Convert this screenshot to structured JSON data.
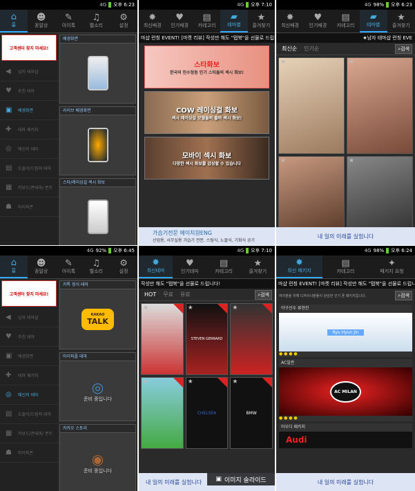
{
  "panels": {
    "p1": {
      "status": {
        "network": "4G",
        "time": "오후 6:23"
      },
      "nav": [
        {
          "label": "홈",
          "icon": "home-icon",
          "glyph": "⌂"
        },
        {
          "label": "꽁알상",
          "icon": "mascot-icon",
          "glyph": "☻"
        },
        {
          "label": "아이톡",
          "icon": "chat-icon",
          "glyph": "✎"
        },
        {
          "label": "벨소리",
          "icon": "music-note-icon",
          "glyph": "♫"
        },
        {
          "label": "설정",
          "icon": "gear-icon",
          "glyph": "⚙"
        }
      ],
      "logo": "고객센터 찾지 마세요!",
      "sidebar": [
        {
          "label": "남자 테마샵",
          "icon": "megaphone-icon",
          "glyph": "◀"
        },
        {
          "label": "추천 테마",
          "icon": "thumb-up-icon",
          "glyph": "♥"
        },
        {
          "label": "배경화면",
          "icon": "image-icon",
          "glyph": "▣"
        },
        {
          "label": "테마 패키지",
          "icon": "gift-icon",
          "glyph": "✚"
        },
        {
          "label": "메신저 테마",
          "icon": "messenger-icon",
          "glyph": "◎"
        },
        {
          "label": "도돌이/드럼져 테마",
          "icon": "app-icon",
          "glyph": "▤"
        },
        {
          "label": "키보드/폰테마/ 폰트",
          "icon": "keyboard-icon",
          "glyph": "▦"
        },
        {
          "label": "마이피폰",
          "icon": "people-icon",
          "glyph": "☗"
        }
      ],
      "cards": [
        {
          "title": "배경화면"
        },
        {
          "title": "라이브 배경화면"
        },
        {
          "title": "스타/레이싱걸 섹시 화보"
        }
      ]
    },
    "p2": {
      "status": {
        "network": "4G",
        "time": "오후 7:10"
      },
      "nav": [
        {
          "label": "최신배경",
          "icon": "new-badge-icon",
          "glyph": "✸"
        },
        {
          "label": "인기배경",
          "icon": "heart-icon",
          "glyph": "♥"
        },
        {
          "label": "카테고리",
          "icon": "category-icon",
          "glyph": "▤"
        },
        {
          "label": "테마별",
          "icon": "folder-icon",
          "glyph": "▰"
        },
        {
          "label": "즐겨찾기",
          "icon": "star-icon",
          "glyph": "★"
        }
      ],
      "ticker": "마샵 런칭 EVENT! [마켓 리뷰] 작성만 해도 \"탭북\"을 선물로 드립니다!",
      "banners": [
        {
          "title": "스타화보",
          "sub": "한국의 인수정등 인기 스타들의 섹시 화보!"
        },
        {
          "title": "COW 레이싱걸 화보",
          "sub": "섹시 레이싱걸 모델들의 출바 섹시 화보!"
        },
        {
          "title": "모바이 섹시 화보",
          "sub": "다양한 섹시 화보를 감상할 수 있습니다"
        }
      ],
      "ad": {
        "title": "가습기전문 에이치원ENG",
        "sub": "산업용, 사무실용 가습기 전문, 스팀식, 노즐식, 기화식 공기"
      }
    },
    "p3": {
      "status": {
        "network": "4G",
        "battery": "98%",
        "time": "오후 6:23"
      },
      "nav": [
        {
          "label": "최신배경",
          "icon": "new-badge-icon",
          "glyph": "✸"
        },
        {
          "label": "인기배경",
          "icon": "heart-icon",
          "glyph": "♥"
        },
        {
          "label": "카테고리",
          "icon": "category-icon",
          "glyph": "▤"
        },
        {
          "label": "테마별",
          "icon": "folder-icon",
          "glyph": "▰"
        },
        {
          "label": "즐겨찾기",
          "icon": "star-icon",
          "glyph": "★"
        }
      ],
      "ticker": "★남자 테마샵 런칭 EVE",
      "tabs": [
        "최신순",
        "인기순"
      ],
      "search": "검색",
      "ad": "내 일의 미래를 실험니다"
    },
    "p4": {
      "status": {
        "network": "4G",
        "battery": "92%",
        "time": "오후 6:45"
      },
      "cards": [
        {
          "title": "카톡 정식 테마",
          "logo": "TALK",
          "sub": "KAKAO"
        },
        {
          "title": "마이피플 테마",
          "body": "준비 중입니다"
        },
        {
          "title": "카카오 스토리",
          "body": "준비 중입니다"
        }
      ]
    },
    "p5": {
      "status": {
        "network": "4G",
        "time": "오후 7:10"
      },
      "nav": [
        {
          "label": "최신테마",
          "icon": "new-badge-icon",
          "glyph": "✸"
        },
        {
          "label": "인기테마",
          "icon": "heart-icon",
          "glyph": "♥"
        },
        {
          "label": "카테고리",
          "icon": "category-icon",
          "glyph": "▤"
        },
        {
          "label": "즐겨찾기",
          "icon": "star-icon",
          "glyph": "★"
        }
      ],
      "ticker": "작성만 해도 \"탭북\"을 선물로 드립니다!",
      "tabs": [
        "HOT",
        "무료",
        "유료"
      ],
      "search": "검색",
      "tiles": [
        "",
        "STEVEN GERRARD",
        "",
        "",
        "CHELSEA",
        "BMW"
      ]
    },
    "p6": {
      "status": {
        "network": "4G",
        "battery": "98%",
        "time": "오후 6:24"
      },
      "nav": [
        {
          "label": "최신 패키지",
          "icon": "new-badge-icon",
          "glyph": "✸"
        },
        {
          "label": "카테고리",
          "icon": "category-icon",
          "glyph": "▤"
        },
        {
          "label": "패키지 요청",
          "icon": "bulb-icon",
          "glyph": "✦"
        }
      ],
      "ticker": "마샵 런칭 EVENT! [마켓 리뷰] 작성만 해도 \"탭북\"을 선물로 드립니다!",
      "notice": "여러분을 위해 디자이너분들이 완성한 인기 폰 패키지입니다.",
      "search": "검색",
      "rows": [
        {
          "label": "야구선수 류현진",
          "text": "Ryu Hyun Jin"
        },
        {
          "label": "AC밀란",
          "text": "AC MILAN"
        },
        {
          "label": "아우디 패키지",
          "text": "Audi"
        }
      ],
      "ad": "내 일의 미래를 실험니다"
    },
    "slideshow": "이미지 슬라이드"
  }
}
